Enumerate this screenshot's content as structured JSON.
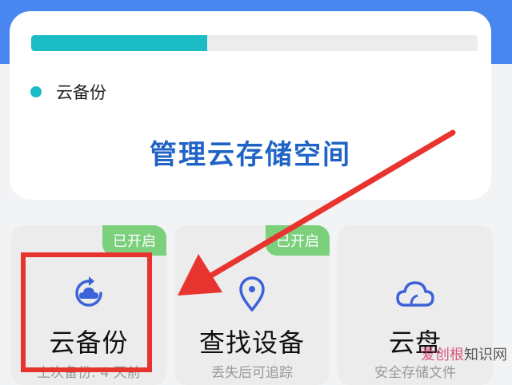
{
  "storage": {
    "used_fraction": 0.395,
    "legend_label": "云备份",
    "manage_label": "管理云存储空间"
  },
  "features": [
    {
      "title": "云备份",
      "subtitle": "上次备份: 4 天前",
      "badge": "已开启",
      "icon": "cloud-backup-icon"
    },
    {
      "title": "查找设备",
      "subtitle": "丢失后可追踪",
      "badge": "已开启",
      "icon": "location-pin-icon"
    },
    {
      "title": "云盘",
      "subtitle": "安全存储文件",
      "badge": "",
      "icon": "cloud-drive-icon"
    }
  ],
  "watermark": {
    "brand": "爱创根",
    "suffix": "知识网"
  },
  "colors": {
    "accent_teal": "#1bbcc6",
    "link_blue": "#1f63c6",
    "badge_green": "#7bd07b",
    "annotation_red": "#e8342e",
    "header_blue": "#4a86f0"
  }
}
